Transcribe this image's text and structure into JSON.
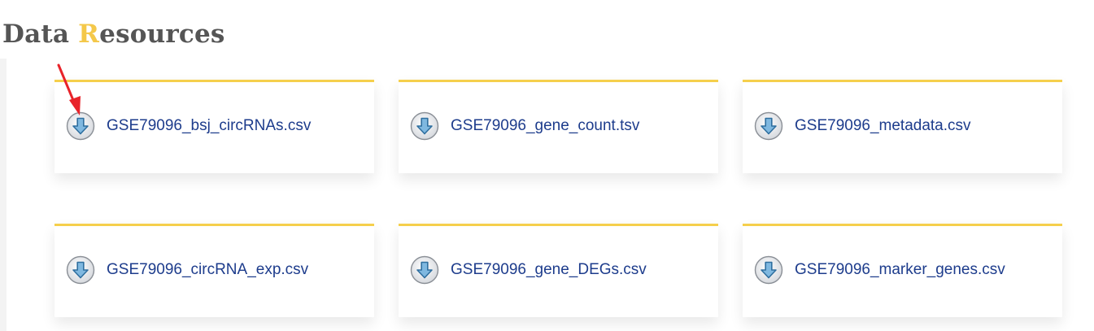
{
  "heading": {
    "first": "Data ",
    "accent": "R",
    "rest": "esources"
  },
  "colors": {
    "accent": "#f4c84a",
    "card_border": "#f5cf4c",
    "link": "#1d3c8c",
    "annotation_arrow": "#e8232a"
  },
  "files": [
    {
      "label": "GSE79096_bsj_circRNAs.csv",
      "icon": "download-icon"
    },
    {
      "label": "GSE79096_gene_count.tsv",
      "icon": "download-icon"
    },
    {
      "label": "GSE79096_metadata.csv",
      "icon": "download-icon"
    },
    {
      "label": "GSE79096_circRNA_exp.csv",
      "icon": "download-icon"
    },
    {
      "label": "GSE79096_gene_DEGs.csv",
      "icon": "download-icon"
    },
    {
      "label": "GSE79096_marker_genes.csv",
      "icon": "download-icon"
    }
  ],
  "annotation": {
    "icon": "red-pointer-arrow-icon"
  }
}
